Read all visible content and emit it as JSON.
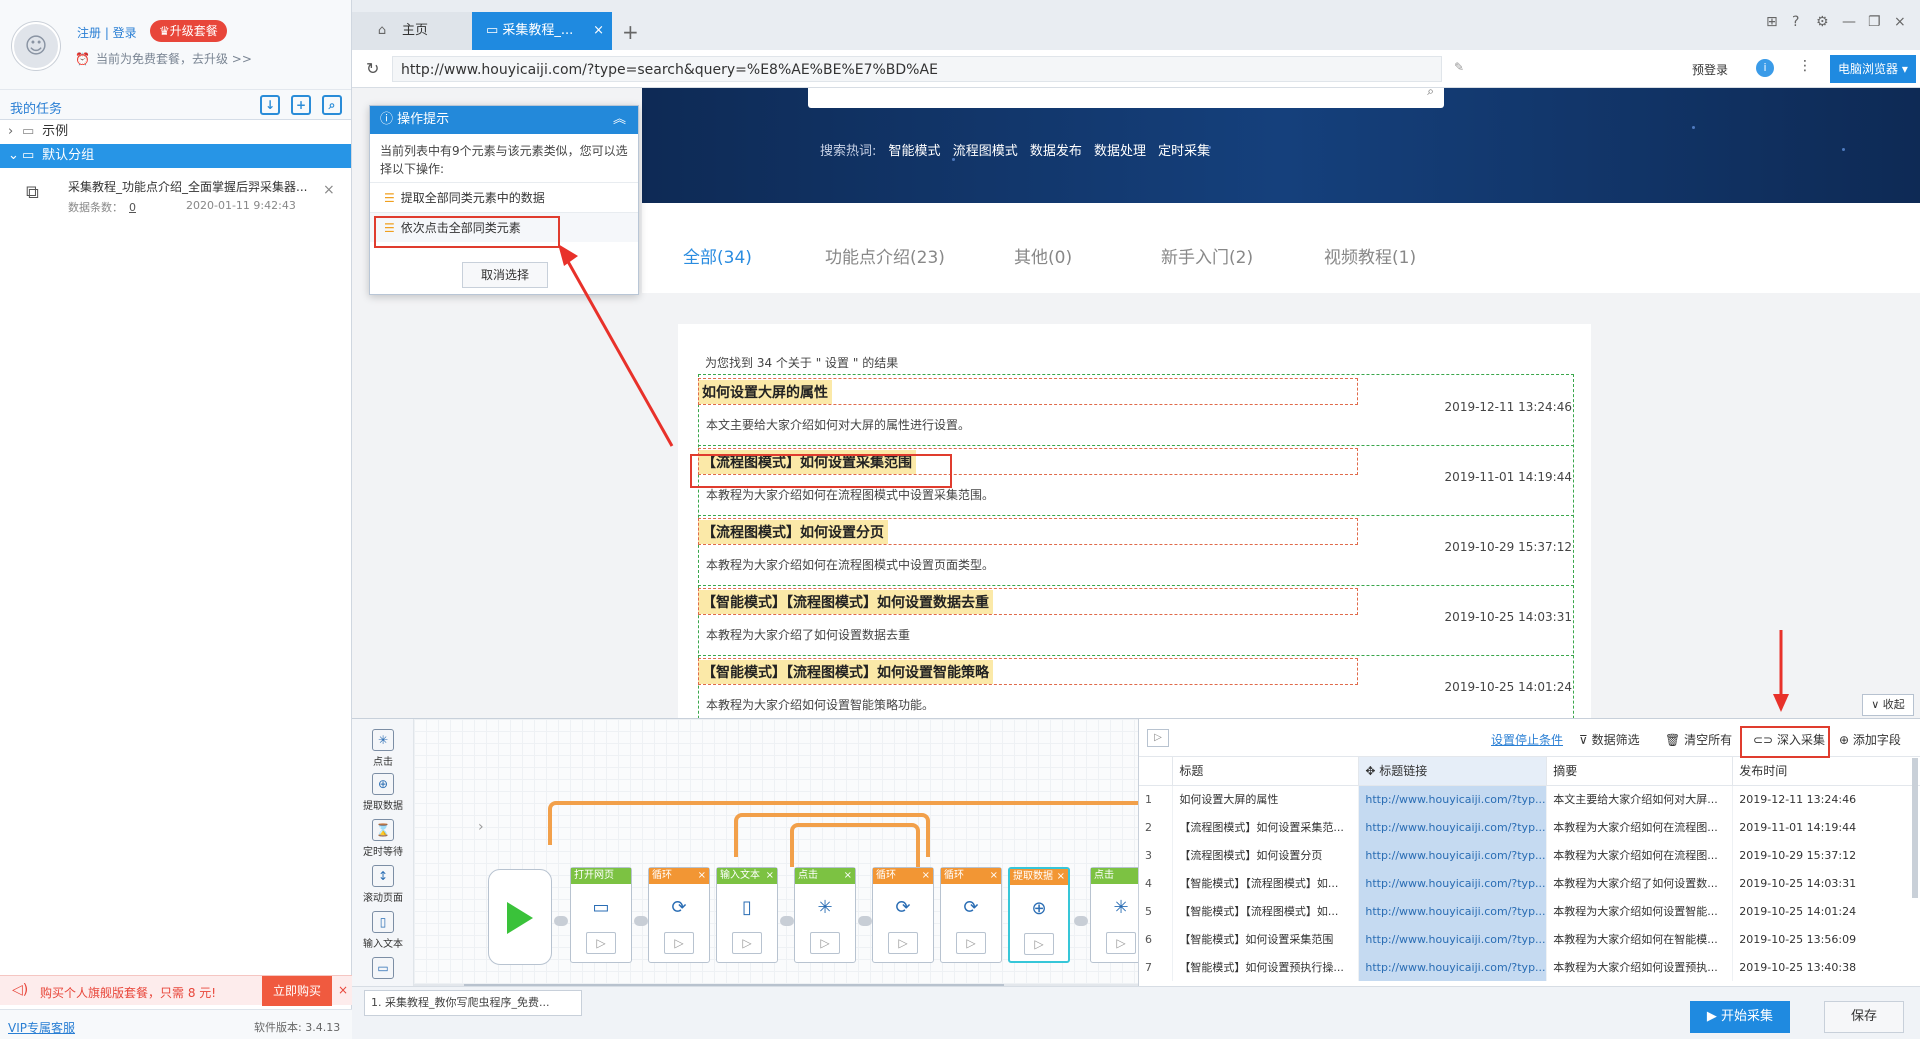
{
  "sidebar": {
    "login_text": "注册 | 登录",
    "upgrade_label": "♛升级套餐",
    "plan_text": "当前为免费套餐，去升级 >>",
    "my_tasks": "我的任务",
    "tree": [
      {
        "label": "示例"
      },
      {
        "label": "默认分组"
      }
    ],
    "task": {
      "name": "采集教程_功能点介绍_全面掌握后羿采集器...",
      "count_label": "数据条数：",
      "count": "0",
      "date": "2020-01-11 9:42:43"
    },
    "promo": {
      "text": "购买个人旗舰版套餐，只需 8 元!",
      "buy": "立即购买"
    },
    "vip": "VIP专属客服",
    "version": "软件版本: 3.4.13"
  },
  "browser": {
    "tabs": [
      {
        "label": "主页"
      },
      {
        "label": "采集教程_..."
      }
    ],
    "url": "http://www.houyicaiji.com/?type=search&query=%E8%AE%BE%E7%BD%AE",
    "prelogin": "预登录",
    "pc_browser": "电脑浏览器"
  },
  "webpage": {
    "hot_label": "搜索热词:",
    "hot_words": [
      "智能模式",
      "流程图模式",
      "数据发布",
      "数据处理",
      "定时采集"
    ],
    "categories": [
      {
        "label": "全部(34)"
      },
      {
        "label": "功能点介绍(23)"
      },
      {
        "label": "其他(0)"
      },
      {
        "label": "新手入门(2)"
      },
      {
        "label": "视频教程(1)"
      }
    ],
    "result_count": "为您找到 34 个关于 \" 设置 \" 的结果",
    "results": [
      {
        "title": "如何设置大屏的属性",
        "date": "2019-12-11 13:24:46",
        "desc": "本文主要给大家介绍如何对大屏的属性进行设置。"
      },
      {
        "title": "【流程图模式】如何设置采集范围",
        "date": "2019-11-01 14:19:44",
        "desc": "本教程为大家介绍如何在流程图模式中设置采集范围。"
      },
      {
        "title": "【流程图模式】如何设置分页",
        "date": "2019-10-29 15:37:12",
        "desc": "本教程为大家介绍如何在流程图模式中设置页面类型。"
      },
      {
        "title": "【智能模式】【流程图模式】如何设置数据去重",
        "date": "2019-10-25 14:03:31",
        "desc": "本教程为大家介绍了如何设置数据去重"
      },
      {
        "title": "【智能模式】【流程图模式】如何设置智能策略",
        "date": "2019-10-25 14:01:24",
        "desc": "本教程为大家介绍如何设置智能策略功能。"
      }
    ],
    "collapse": "∨ 收起"
  },
  "tips": {
    "title": "操作提示",
    "message": "当前列表中有9个元素与该元素类似，您可以选择以下操作:",
    "options": [
      "提取全部同类元素中的数据",
      "依次点击全部同类元素"
    ],
    "cancel": "取消选择"
  },
  "workflow": {
    "tools": [
      "点击",
      "提取数据",
      "定时等待",
      "滚动页面",
      "输入文本"
    ],
    "nodes": [
      {
        "label": "打开网页",
        "icon": "▭"
      },
      {
        "label": "循环",
        "icon": "⟳"
      },
      {
        "label": "输入文本",
        "icon": "▯"
      },
      {
        "label": "点击",
        "icon": "✳"
      },
      {
        "label": "循环",
        "icon": "⟳"
      },
      {
        "label": "循环",
        "icon": "⟳"
      },
      {
        "label": "提取数据",
        "icon": "⊕"
      },
      {
        "label": "点击",
        "icon": "✳"
      }
    ]
  },
  "datatable": {
    "toolbar": {
      "stop_cond": "设置停止条件",
      "filter": "数据筛选",
      "clear": "清空所有",
      "deep": "深入采集",
      "add_field": "添加字段"
    },
    "columns": [
      "标题",
      "标题链接",
      "摘要",
      "发布时间"
    ],
    "rows": [
      [
        "1",
        "如何设置大屏的属性",
        "http://www.houyicaiji.com/?typ...",
        "本文主要给大家介绍如何对大屏...",
        "2019-12-11 13:24:46"
      ],
      [
        "2",
        "【流程图模式】如何设置采集范...",
        "http://www.houyicaiji.com/?typ...",
        "本教程为大家介绍如何在流程图...",
        "2019-11-01 14:19:44"
      ],
      [
        "3",
        "【流程图模式】如何设置分页",
        "http://www.houyicaiji.com/?typ...",
        "本教程为大家介绍如何在流程图...",
        "2019-10-29 15:37:12"
      ],
      [
        "4",
        "【智能模式】【流程图模式】如...",
        "http://www.houyicaiji.com/?typ...",
        "本教程为大家介绍了如何设置数...",
        "2019-10-25 14:03:31"
      ],
      [
        "5",
        "【智能模式】【流程图模式】如...",
        "http://www.houyicaiji.com/?typ...",
        "本教程为大家介绍如何设置智能...",
        "2019-10-25 14:01:24"
      ],
      [
        "6",
        "【智能模式】如何设置采集范围",
        "http://www.houyicaiji.com/?typ...",
        "本教程为大家介绍如何在智能模...",
        "2019-10-25 13:56:09"
      ],
      [
        "7",
        "【智能模式】如何设置预执行操...",
        "http://www.houyicaiji.com/?typ...",
        "本教程为大家介绍如何设置预执...",
        "2019-10-25 13:40:38"
      ]
    ]
  },
  "bottom": {
    "task_tab": "1. 采集教程_教你写爬虫程序_免费...",
    "start": "▶ 开始采集",
    "save": "保存"
  }
}
